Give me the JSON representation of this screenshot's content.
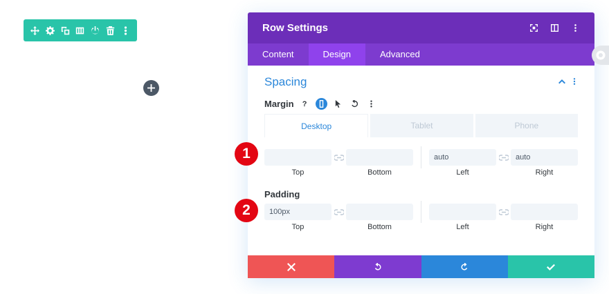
{
  "colors": {
    "toolbar_teal": "#29c4a9",
    "header_purple": "#6c2eb9",
    "tabs_purple": "#7d3bcf",
    "active_tab_purple": "#8f42ec",
    "accent_blue": "#2b87da",
    "cancel_red": "#ef5555",
    "callout_red": "#e30613"
  },
  "row_toolbar": {
    "icons": [
      "move-icon",
      "gear-icon",
      "duplicate-icon",
      "columns-icon",
      "power-icon",
      "trash-icon",
      "more-vertical-icon"
    ]
  },
  "modal": {
    "title": "Row Settings",
    "header_icons": [
      "fullscreen-icon",
      "split-view-icon",
      "more-vertical-icon"
    ],
    "tabs": [
      {
        "label": "Content",
        "active": false
      },
      {
        "label": "Design",
        "active": true
      },
      {
        "label": "Advanced",
        "active": false
      }
    ],
    "section": {
      "title": "Spacing",
      "margin": {
        "label": "Margin",
        "help": "?",
        "device_tabs": [
          {
            "label": "Desktop",
            "active": true
          },
          {
            "label": "Tablet",
            "active": false
          },
          {
            "label": "Phone",
            "active": false
          }
        ],
        "fields": {
          "top": {
            "label": "Top",
            "value": ""
          },
          "bottom": {
            "label": "Bottom",
            "value": ""
          },
          "left": {
            "label": "Left",
            "value": "auto"
          },
          "right": {
            "label": "Right",
            "value": "auto"
          }
        }
      },
      "padding": {
        "label": "Padding",
        "fields": {
          "top": {
            "label": "Top",
            "value": "100px"
          },
          "bottom": {
            "label": "Bottom",
            "value": ""
          },
          "left": {
            "label": "Left",
            "value": ""
          },
          "right": {
            "label": "Right",
            "value": ""
          }
        }
      }
    },
    "footer": [
      "close-icon",
      "undo-icon",
      "redo-icon",
      "check-icon"
    ]
  },
  "callouts": [
    "1",
    "2"
  ]
}
